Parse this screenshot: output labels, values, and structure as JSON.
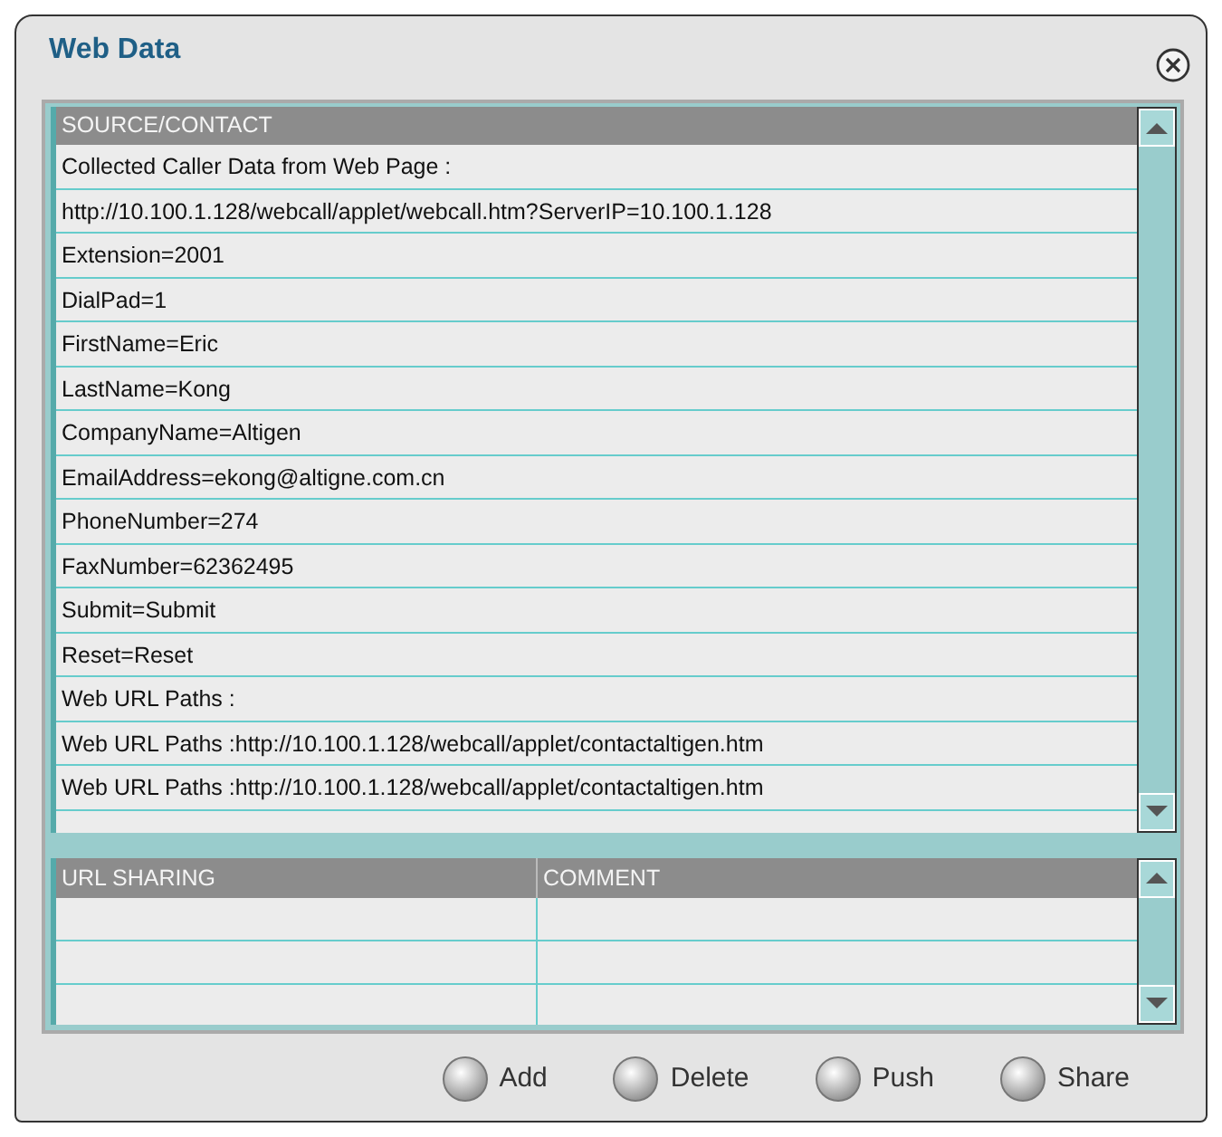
{
  "window": {
    "title": "Web Data"
  },
  "source_table": {
    "header": "SOURCE/CONTACT",
    "rows": [
      "Collected Caller Data from Web Page :",
      "http://10.100.1.128/webcall/applet/webcall.htm?ServerIP=10.100.1.128",
      "Extension=2001",
      "DialPad=1",
      "FirstName=Eric",
      "LastName=Kong",
      "CompanyName=Altigen",
      "EmailAddress=ekong@altigne.com.cn",
      "PhoneNumber=274",
      "FaxNumber=62362495",
      "Submit=Submit",
      "Reset=Reset",
      "Web URL Paths :",
      "Web URL Paths :http://10.100.1.128/webcall/applet/contactaltigen.htm",
      "Web URL Paths :http://10.100.1.128/webcall/applet/contactaltigen.htm"
    ]
  },
  "url_table": {
    "columns": [
      "URL SHARING",
      "COMMENT"
    ]
  },
  "buttons": [
    "Add",
    "Delete",
    "Push",
    "Share"
  ]
}
